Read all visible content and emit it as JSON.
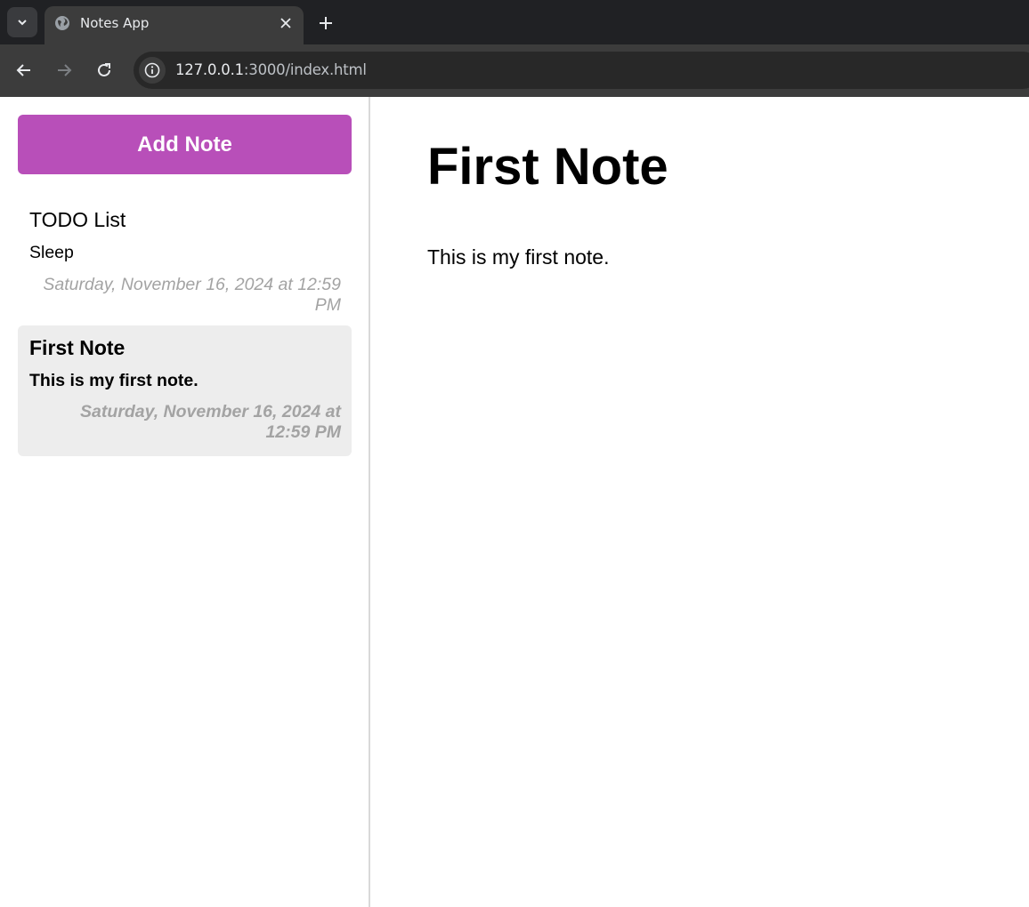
{
  "browser": {
    "tab_title": "Notes App",
    "url_host": "127.0.0.1",
    "url_rest": ":3000/index.html"
  },
  "sidebar": {
    "add_button_label": "Add Note",
    "notes": [
      {
        "title": "TODO List",
        "body": "Sleep",
        "date": "Saturday, November 16, 2024 at 12:59 PM",
        "active": false
      },
      {
        "title": "First Note",
        "body": "This is my first note.",
        "date": "Saturday, November 16, 2024 at 12:59 PM",
        "active": true
      }
    ]
  },
  "main": {
    "title": "First Note",
    "body": "This is my first note."
  },
  "colors": {
    "accent": "#b84fb9",
    "active_note_bg": "#ededed",
    "date_text": "#a3a3a3"
  }
}
